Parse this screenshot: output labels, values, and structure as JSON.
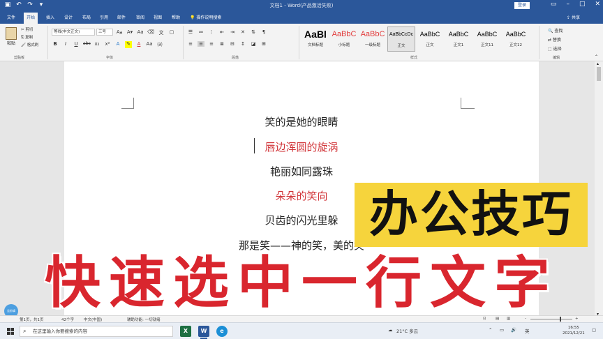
{
  "titlebar": {
    "doc_title": "文档1 - Word(产品激活失败)",
    "login_label": "登录",
    "qat_icons": [
      "save-icon",
      "undo-icon",
      "redo-icon"
    ],
    "window_controls": [
      "minimize-icon",
      "restore-icon",
      "close-icon"
    ]
  },
  "tabs": {
    "items": [
      "文件",
      "开始",
      "插入",
      "设计",
      "布局",
      "引用",
      "邮件",
      "审阅",
      "视图",
      "帮助"
    ],
    "active": "开始",
    "tell_me": "操作说明搜索",
    "share_label": "共享"
  },
  "ribbon": {
    "clipboard": {
      "paste": "粘贴",
      "cut": "剪切",
      "copy": "复制",
      "format_painter": "格式刷",
      "group_label": "剪贴板"
    },
    "font": {
      "font_name": "等线(中文正文)",
      "font_size": "三号",
      "group_label": "字体",
      "row2": [
        "B",
        "I",
        "U",
        "abc",
        "x₂",
        "x²",
        "A",
        "✎",
        "A",
        "Aa",
        "A",
        "⒜"
      ]
    },
    "paragraph": {
      "group_label": "段落"
    },
    "styles": {
      "items": [
        {
          "preview": "AaBl",
          "name": "文档标题",
          "color": "#000000",
          "bold": true,
          "size": 14
        },
        {
          "preview": "AaBbC",
          "name": "小标题",
          "color": "#e23b3b",
          "bold": false,
          "size": 11
        },
        {
          "preview": "AaBbC",
          "name": "一级标题",
          "color": "#e23b3b",
          "bold": false,
          "size": 11
        },
        {
          "preview": "AaBbCcDc",
          "name": "正文",
          "color": "#000000",
          "bold": false,
          "size": 7
        },
        {
          "preview": "AaBbC",
          "name": "正文",
          "color": "#000000",
          "bold": false,
          "size": 9
        },
        {
          "preview": "AaBbC",
          "name": "正文1",
          "color": "#000000",
          "bold": false,
          "size": 9
        },
        {
          "preview": "AaBbC",
          "name": "正文11",
          "color": "#000000",
          "bold": false,
          "size": 9
        },
        {
          "preview": "AaBbC",
          "name": "正文12",
          "color": "#000000",
          "bold": false,
          "size": 9
        }
      ],
      "selected_index": 3,
      "group_label": "样式"
    },
    "editing": {
      "find": "查找",
      "replace": "替换",
      "select": "选择",
      "group_label": "编辑"
    }
  },
  "document": {
    "lines": [
      {
        "text": "笑的是她的眼睛",
        "color": "black"
      },
      {
        "text": "唇边浑圆的旋涡",
        "color": "red"
      },
      {
        "text": "艳丽如同露珠",
        "color": "black"
      },
      {
        "text": "朵朵的笑向",
        "color": "red"
      },
      {
        "text": "贝齿的闪光里躲",
        "color": "black"
      },
      {
        "text": "那是笑——神的笑，美的笑",
        "color": "black"
      }
    ]
  },
  "overlay": {
    "title": "办公技巧",
    "caption": "快速选中一行文字",
    "badge": "云剪辑"
  },
  "statusbar": {
    "page": "第1页，共1页",
    "words": "42个字",
    "language": "中文(中国)",
    "accessibility": "辅助功能: 一切就绪",
    "zoom_minus": "-",
    "zoom_plus": "+"
  },
  "taskbar": {
    "search_placeholder": "在这里输入你要搜索的内容",
    "apps": [
      {
        "icon": "excel-icon",
        "letter": "X",
        "color": "#1d6f42"
      },
      {
        "icon": "word-icon",
        "letter": "W",
        "color": "#2b579a"
      },
      {
        "icon": "edge-icon",
        "letter": "e",
        "color": "#1b8fd6"
      }
    ],
    "weather": "21°C 多云",
    "ime": "英",
    "time": "16:55",
    "date": "2021/12/21"
  },
  "colors": {
    "word_blue": "#2b579a",
    "doc_red": "#d13438",
    "overlay_yellow": "#f6d43c",
    "overlay_red": "#d9262e"
  }
}
